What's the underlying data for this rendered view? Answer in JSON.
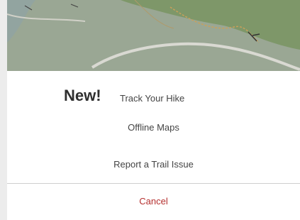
{
  "map": {
    "background": "#9aa794",
    "park_color": "#7f9a6a",
    "road_color": "#d8d8d0",
    "trail_color": "#c9a05a"
  },
  "sheet": {
    "badge_new": "New!",
    "track_label": "Track Your Hike",
    "offline_label": "Offline Maps",
    "report_label": "Report a Trail Issue",
    "cancel_label": "Cancel",
    "cancel_color": "#b5302f"
  }
}
